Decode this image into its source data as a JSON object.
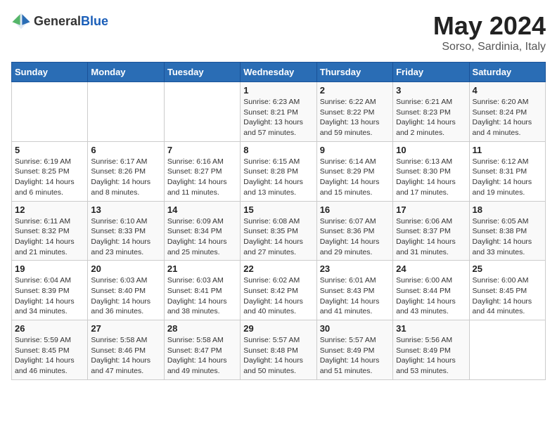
{
  "header": {
    "logo_general": "General",
    "logo_blue": "Blue",
    "month_title": "May 2024",
    "location": "Sorso, Sardinia, Italy"
  },
  "days_of_week": [
    "Sunday",
    "Monday",
    "Tuesday",
    "Wednesday",
    "Thursday",
    "Friday",
    "Saturday"
  ],
  "weeks": [
    [
      {
        "day": "",
        "info": ""
      },
      {
        "day": "",
        "info": ""
      },
      {
        "day": "",
        "info": ""
      },
      {
        "day": "1",
        "info": "Sunrise: 6:23 AM\nSunset: 8:21 PM\nDaylight: 13 hours\nand 57 minutes."
      },
      {
        "day": "2",
        "info": "Sunrise: 6:22 AM\nSunset: 8:22 PM\nDaylight: 13 hours\nand 59 minutes."
      },
      {
        "day": "3",
        "info": "Sunrise: 6:21 AM\nSunset: 8:23 PM\nDaylight: 14 hours\nand 2 minutes."
      },
      {
        "day": "4",
        "info": "Sunrise: 6:20 AM\nSunset: 8:24 PM\nDaylight: 14 hours\nand 4 minutes."
      }
    ],
    [
      {
        "day": "5",
        "info": "Sunrise: 6:19 AM\nSunset: 8:25 PM\nDaylight: 14 hours\nand 6 minutes."
      },
      {
        "day": "6",
        "info": "Sunrise: 6:17 AM\nSunset: 8:26 PM\nDaylight: 14 hours\nand 8 minutes."
      },
      {
        "day": "7",
        "info": "Sunrise: 6:16 AM\nSunset: 8:27 PM\nDaylight: 14 hours\nand 11 minutes."
      },
      {
        "day": "8",
        "info": "Sunrise: 6:15 AM\nSunset: 8:28 PM\nDaylight: 14 hours\nand 13 minutes."
      },
      {
        "day": "9",
        "info": "Sunrise: 6:14 AM\nSunset: 8:29 PM\nDaylight: 14 hours\nand 15 minutes."
      },
      {
        "day": "10",
        "info": "Sunrise: 6:13 AM\nSunset: 8:30 PM\nDaylight: 14 hours\nand 17 minutes."
      },
      {
        "day": "11",
        "info": "Sunrise: 6:12 AM\nSunset: 8:31 PM\nDaylight: 14 hours\nand 19 minutes."
      }
    ],
    [
      {
        "day": "12",
        "info": "Sunrise: 6:11 AM\nSunset: 8:32 PM\nDaylight: 14 hours\nand 21 minutes."
      },
      {
        "day": "13",
        "info": "Sunrise: 6:10 AM\nSunset: 8:33 PM\nDaylight: 14 hours\nand 23 minutes."
      },
      {
        "day": "14",
        "info": "Sunrise: 6:09 AM\nSunset: 8:34 PM\nDaylight: 14 hours\nand 25 minutes."
      },
      {
        "day": "15",
        "info": "Sunrise: 6:08 AM\nSunset: 8:35 PM\nDaylight: 14 hours\nand 27 minutes."
      },
      {
        "day": "16",
        "info": "Sunrise: 6:07 AM\nSunset: 8:36 PM\nDaylight: 14 hours\nand 29 minutes."
      },
      {
        "day": "17",
        "info": "Sunrise: 6:06 AM\nSunset: 8:37 PM\nDaylight: 14 hours\nand 31 minutes."
      },
      {
        "day": "18",
        "info": "Sunrise: 6:05 AM\nSunset: 8:38 PM\nDaylight: 14 hours\nand 33 minutes."
      }
    ],
    [
      {
        "day": "19",
        "info": "Sunrise: 6:04 AM\nSunset: 8:39 PM\nDaylight: 14 hours\nand 34 minutes."
      },
      {
        "day": "20",
        "info": "Sunrise: 6:03 AM\nSunset: 8:40 PM\nDaylight: 14 hours\nand 36 minutes."
      },
      {
        "day": "21",
        "info": "Sunrise: 6:03 AM\nSunset: 8:41 PM\nDaylight: 14 hours\nand 38 minutes."
      },
      {
        "day": "22",
        "info": "Sunrise: 6:02 AM\nSunset: 8:42 PM\nDaylight: 14 hours\nand 40 minutes."
      },
      {
        "day": "23",
        "info": "Sunrise: 6:01 AM\nSunset: 8:43 PM\nDaylight: 14 hours\nand 41 minutes."
      },
      {
        "day": "24",
        "info": "Sunrise: 6:00 AM\nSunset: 8:44 PM\nDaylight: 14 hours\nand 43 minutes."
      },
      {
        "day": "25",
        "info": "Sunrise: 6:00 AM\nSunset: 8:45 PM\nDaylight: 14 hours\nand 44 minutes."
      }
    ],
    [
      {
        "day": "26",
        "info": "Sunrise: 5:59 AM\nSunset: 8:45 PM\nDaylight: 14 hours\nand 46 minutes."
      },
      {
        "day": "27",
        "info": "Sunrise: 5:58 AM\nSunset: 8:46 PM\nDaylight: 14 hours\nand 47 minutes."
      },
      {
        "day": "28",
        "info": "Sunrise: 5:58 AM\nSunset: 8:47 PM\nDaylight: 14 hours\nand 49 minutes."
      },
      {
        "day": "29",
        "info": "Sunrise: 5:57 AM\nSunset: 8:48 PM\nDaylight: 14 hours\nand 50 minutes."
      },
      {
        "day": "30",
        "info": "Sunrise: 5:57 AM\nSunset: 8:49 PM\nDaylight: 14 hours\nand 51 minutes."
      },
      {
        "day": "31",
        "info": "Sunrise: 5:56 AM\nSunset: 8:49 PM\nDaylight: 14 hours\nand 53 minutes."
      },
      {
        "day": "",
        "info": ""
      }
    ]
  ]
}
